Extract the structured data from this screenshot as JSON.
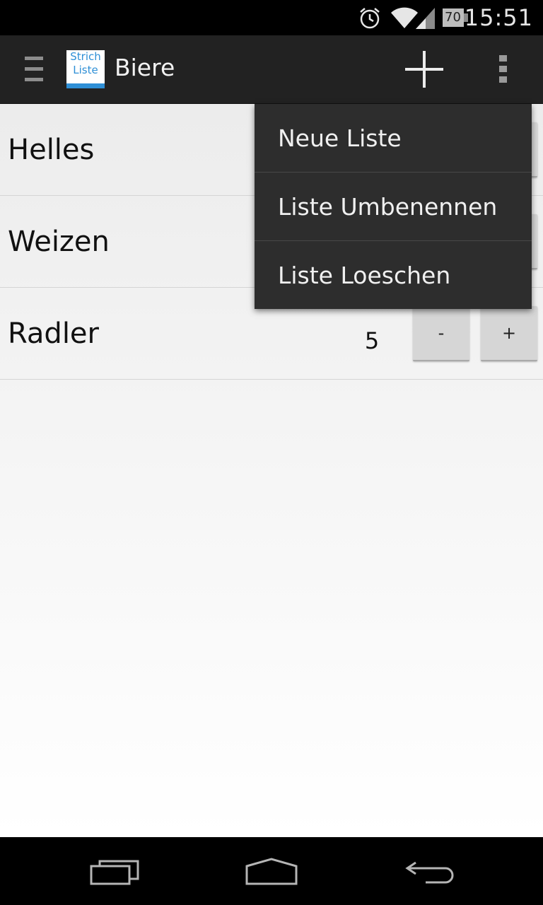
{
  "status_bar": {
    "time": "15:51",
    "battery_level": "70",
    "icons": [
      "alarm-icon",
      "wifi-icon",
      "signal-icon",
      "battery-icon"
    ]
  },
  "action_bar": {
    "title": "Biere",
    "logo_line1": "Strich",
    "logo_line2": "Liste",
    "icons": [
      "drawer-icon",
      "add-icon",
      "overflow-menu-icon"
    ]
  },
  "list": {
    "items": [
      {
        "name": "Helles",
        "count": "",
        "minus_label": "-",
        "plus_label": "+"
      },
      {
        "name": "Weizen",
        "count": "",
        "minus_label": "-",
        "plus_label": "+"
      },
      {
        "name": "Radler",
        "count": "5",
        "minus_label": "-",
        "plus_label": "+"
      }
    ]
  },
  "overflow_menu": {
    "items": [
      {
        "label": "Neue Liste"
      },
      {
        "label": "Liste Umbenennen"
      },
      {
        "label": "Liste Loeschen"
      }
    ]
  },
  "nav_bar": {
    "icons": [
      "recent-apps-icon",
      "home-icon",
      "back-icon"
    ]
  },
  "colors": {
    "action_bar": "#222222",
    "menu_background": "#2d2d2d",
    "logo_accent": "#2e8fd6",
    "button": "#d6d6d6"
  }
}
